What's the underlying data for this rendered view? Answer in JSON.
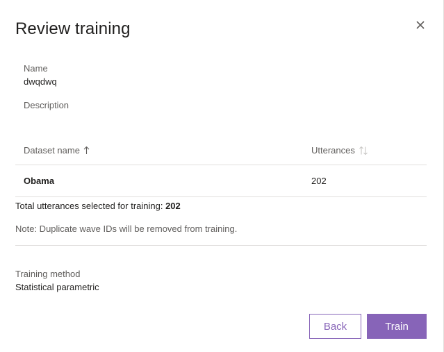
{
  "dialog": {
    "title": "Review training",
    "close_icon": "close-icon"
  },
  "fields": {
    "name_label": "Name",
    "name_value": "dwqdwq",
    "description_label": "Description",
    "description_value": ""
  },
  "table": {
    "columns": [
      {
        "label": "Dataset name",
        "sort_icon": "sort-ascending-arrow-icon"
      },
      {
        "label": "Utterances",
        "sort_icon": "sort-updown-icon"
      }
    ],
    "rows": [
      {
        "dataset_name": "Obama",
        "utterances": "202"
      }
    ]
  },
  "summary": {
    "total_label": "Total utterances selected for training:",
    "total_value": "202",
    "note": "Note: Duplicate wave IDs will be removed from training."
  },
  "training": {
    "method_label": "Training method",
    "method_value": "Statistical parametric"
  },
  "buttons": {
    "back": "Back",
    "train": "Train"
  },
  "colors": {
    "accent": "#8764b8",
    "divider": "#e1dfdd",
    "secondary_text": "#605e5c",
    "primary_text": "#201f1e"
  }
}
